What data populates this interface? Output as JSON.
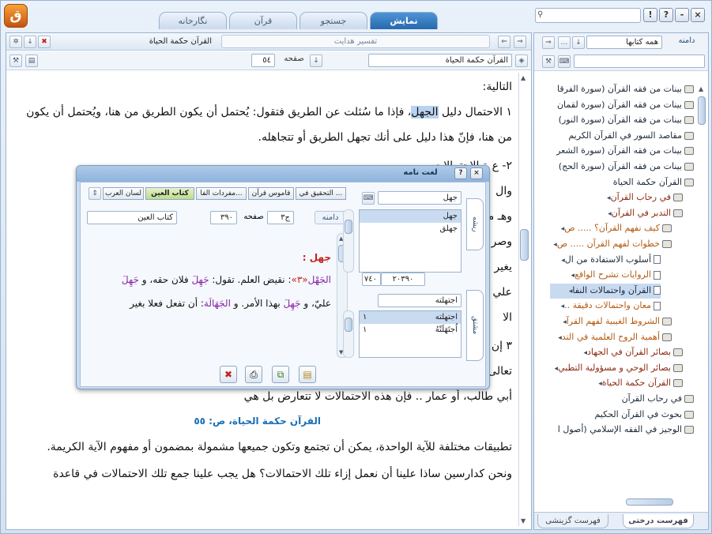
{
  "app": {
    "logo_glyph": "ق"
  },
  "tabs": [
    {
      "label": "نمایش",
      "active": true
    },
    {
      "label": "جستجو",
      "active": false
    },
    {
      "label": "قرآن",
      "active": false
    },
    {
      "label": "نگارخانه",
      "active": false
    }
  ],
  "window_buttons": [
    "!",
    "?",
    "-",
    "×"
  ],
  "main": {
    "book_tab_title": "القرآن حكمة الحياة",
    "secondary_book": "تفسير هدايت",
    "book_field": "القرآن حكمة الحياة",
    "page_label": "صفحه",
    "page_value": "٥٤",
    "lines": [
      "التالية:",
      "١ الاحتمال دليل الجهل، فإذا ما سُئلت عن الطريق فتقول: يُحتمل أن يكون الطريق من هنا، ويُحتمل أن يكون",
      "من هنا، فإنّ هذا دليل على أنك تجهل الطريق أو تتجاهله.",
      "٢- ع                                                                             ة الاحتمالات",
      "وال",
      "وهـ                                                                                     متعددة،",
      "وصر                                                                              اليقين، ولا",
      "يغير                                                                             في قدرتك",
      "علي                                                                            عند حدود",
      "الا",
      "٣ إن                                                                              ما ينزل قوله",
      "تعالى                                                                       أو جعفر بن",
      "أبي طالب، أو عمار .. فإن هذه الاحتمالات لا تتعارض بل هي",
      "القرآن حكمة الحياة، ص: ٥٥",
      "تطبيقات مختلفة للآية الواحدة، يمكن أن تجتمع وتكون جميعها مشمولة بمضمون أو مفهوم الآية الكريمة.",
      "ونحن كدارسين ساذا علينا أن نعمل إزاء تلك الاحتمالات؟ هل يجب علينا جمع تلك الاحتمالات في قاعدة"
    ]
  },
  "tree": {
    "tab_label": "دامنه",
    "scope_select": "همه کتابها",
    "items": [
      {
        "text": "بينات من فقه القرآن (سورة الفرقا",
        "icon": "book",
        "indent": 0,
        "color": "normal"
      },
      {
        "text": "بينات من فقه القرآن (سورة لقمان",
        "icon": "book",
        "indent": 0,
        "color": "normal"
      },
      {
        "text": "بينات من فقه القرآن (سورة النور)",
        "icon": "book",
        "indent": 0,
        "color": "normal"
      },
      {
        "text": "مقاصد السور في القرآن الكريم",
        "icon": "book",
        "indent": 0,
        "color": "normal"
      },
      {
        "text": "بينات من فقه القرآن (سورة الشعر",
        "icon": "book",
        "indent": 0,
        "color": "normal"
      },
      {
        "text": "بينات من فقه القرآن (سورة الحج)",
        "icon": "book",
        "indent": 0,
        "color": "normal"
      },
      {
        "text": "القرآن حكمة الحياة",
        "icon": "open",
        "indent": 0,
        "color": "normal"
      },
      {
        "text": "في رحاب القرآن",
        "icon": "book",
        "indent": 1,
        "color": "red"
      },
      {
        "text": "التدبر في القرآن",
        "icon": "open",
        "indent": 1,
        "color": "red"
      },
      {
        "text": "كيف نفهم القرآن؟ ..... ص",
        "icon": "book",
        "indent": 2,
        "color": "orange"
      },
      {
        "text": "خطوات لفهم القرآن ..... ص",
        "icon": "open",
        "indent": 2,
        "color": "orange"
      },
      {
        "text": "أسلوب الاستفادة من ال",
        "icon": "page",
        "indent": 3,
        "color": "normal"
      },
      {
        "text": "الروايات تشرح الواقع",
        "icon": "page",
        "indent": 3,
        "color": "orange"
      },
      {
        "text": "القرآن واحتمالات النفا",
        "icon": "page",
        "indent": 3,
        "color": "normal",
        "selected": true
      },
      {
        "text": "معان واحتمالات دقيقة ..",
        "icon": "page",
        "indent": 3,
        "color": "orange"
      },
      {
        "text": "الشروط الغيبية لفهم القرآ",
        "icon": "book",
        "indent": 2,
        "color": "orange"
      },
      {
        "text": "أهمية الروح العلمية في التد",
        "icon": "book",
        "indent": 2,
        "color": "orange"
      },
      {
        "text": "بصائر القرآن في الجهاد",
        "icon": "book",
        "indent": 1,
        "color": "red"
      },
      {
        "text": "بصائر الوحي و مسؤولية التطبي",
        "icon": "book",
        "indent": 1,
        "color": "red"
      },
      {
        "text": "القرآن حكمة الحياة",
        "icon": "book",
        "indent": 1,
        "color": "red"
      },
      {
        "text": "في رحاب القرآن",
        "icon": "book",
        "indent": 0,
        "color": "normal"
      },
      {
        "text": "بحوث في القرآن الحكيم",
        "icon": "book",
        "indent": 0,
        "color": "normal"
      },
      {
        "text": "الوجيز في الفقه الإسلامي (أصول ا",
        "icon": "book",
        "indent": 0,
        "color": "normal"
      }
    ],
    "bottom_tabs": [
      {
        "label": "فهرست درختی",
        "active": true
      },
      {
        "label": "فهرست گزینشی",
        "active": false
      }
    ]
  },
  "dialog": {
    "title": "لغت نامه",
    "dict_tabs": [
      {
        "label": "لسان العرب",
        "active": false
      },
      {
        "label": "كتاب العين",
        "active": true
      },
      {
        "label": "مفردات الفا...",
        "active": false
      },
      {
        "label": "قاموس قرآن",
        "active": false
      },
      {
        "label": "التحقيق في ...",
        "active": false
      }
    ],
    "scope_label": "دامنه",
    "book_name": "كتاب العين",
    "page_label": "صفحه",
    "page_value": "٣٩٠",
    "volume_value": "ج٣",
    "root_input": "جهل",
    "root_list": [
      {
        "text": "جهل",
        "count": "",
        "selected": true
      },
      {
        "text": "جهلق",
        "count": "",
        "selected": false
      }
    ],
    "root_tab": "ریشه",
    "range": {
      "from": "٢٠٣٩٠",
      "to": "١٧٤٠"
    },
    "word_input": "اجتهلته",
    "word_list": [
      {
        "text": "اجتهلته",
        "count": "١",
        "selected": true
      },
      {
        "text": "اُجتَهَلَتْهُ",
        "count": "١",
        "selected": false
      }
    ],
    "word_tab": "مشتق",
    "definition": {
      "heading": "جهل :",
      "term": "الجَهْل",
      "ref": "«٣»",
      "line1_rest": ": نقيض العلم",
      "line1_b": ". تقول: ",
      "w1": "جَهِلَ",
      "line1_c": " فلان حقه، و ",
      "w2": "جَهِلَ",
      "line2_a": "عليّ، و ",
      "w3": "جَهِلَ",
      "line2_b": " بهذا الأمر. و ",
      "w4": "الجَهَالَة",
      "line2_c": ": أن تفعل فعلا بغير"
    },
    "buttons": [
      "close",
      "print",
      "copy",
      "save"
    ]
  }
}
